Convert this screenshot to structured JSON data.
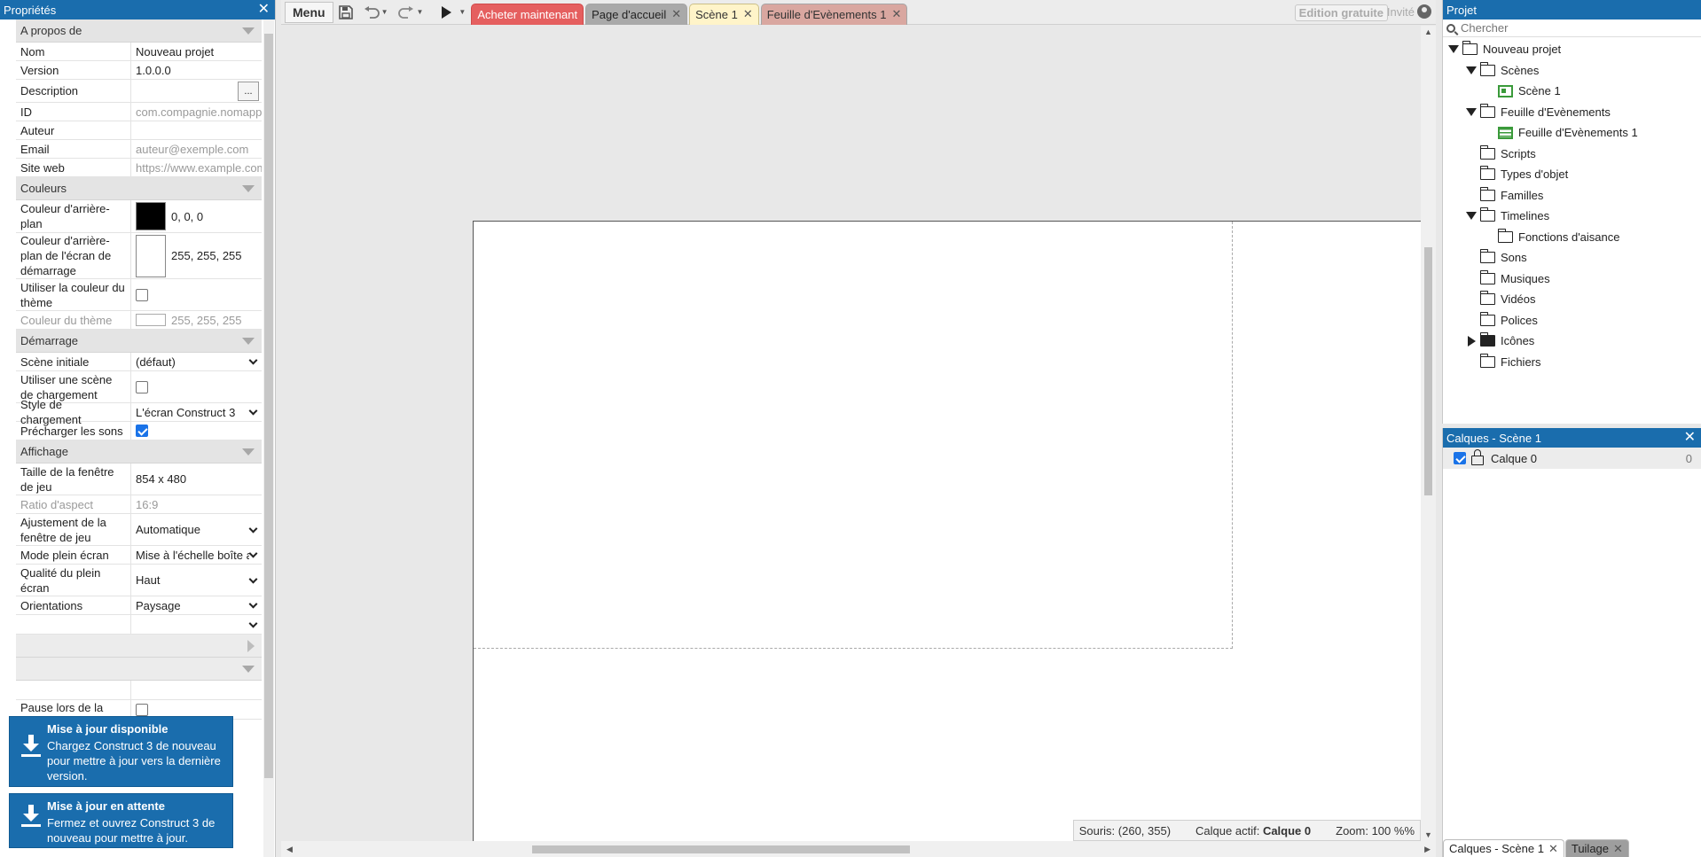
{
  "properties": {
    "header": "Propriétés",
    "sections": {
      "about": "A propos de",
      "colors": "Couleurs",
      "startup": "Démarrage",
      "display": "Affichage"
    },
    "about": {
      "name_label": "Nom",
      "name_value": "Nouveau projet",
      "version_label": "Version",
      "version_value": "1.0.0.0",
      "description_label": "Description",
      "description_button": "...",
      "id_label": "ID",
      "id_placeholder": "com.compagnie.nomapp",
      "author_label": "Auteur",
      "email_label": "Email",
      "email_placeholder": "auteur@exemple.com",
      "website_label": "Site web",
      "website_placeholder": "https://www.example.com"
    },
    "colors": {
      "bg_label": "Couleur d'arrière-plan",
      "bg_value": "0, 0, 0",
      "bg_color": "#000000",
      "splash_label": "Couleur d'arrière-plan de l'écran de démarrage",
      "splash_value": "255, 255, 255",
      "splash_color": "#ffffff",
      "use_theme_label": "Utiliser la couleur du thème",
      "use_theme_checked": false,
      "theme_label": "Couleur du thème",
      "theme_value": "255, 255, 255"
    },
    "startup": {
      "first_scene_label": "Scène initiale",
      "first_scene_value": "(défaut)",
      "use_loader_label": "Utiliser une scène de chargement",
      "use_loader_checked": false,
      "loader_style_label": "Style de chargement",
      "loader_style_value": "L'écran Construct 3",
      "preload_sounds_label": "Précharger les sons",
      "preload_sounds_checked": true
    },
    "display": {
      "viewport_label": "Taille de la fenêtre de jeu",
      "viewport_value": "854 x 480",
      "aspect_label": "Ratio d'aspect",
      "aspect_value": "16:9",
      "fit_label": "Ajustement de la fenêtre de jeu",
      "fit_value": "Automatique",
      "fullscreen_label": "Mode plein écran",
      "fullscreen_value": "Mise à l'échelle boîte aux lettres",
      "quality_label": "Qualité du plein écran",
      "quality_value": "Haut",
      "orient_label": "Orientations",
      "orient_value": "Paysage",
      "pause_label": "Pause lors de la"
    }
  },
  "notifications": [
    {
      "title": "Mise à jour disponible",
      "message": "Chargez Construct 3 de nouveau pour mettre à jour vers la dernière version."
    },
    {
      "title": "Mise à jour en attente",
      "message": "Fermez et ouvrez Construct 3 de nouveau pour mettre à jour."
    }
  ],
  "toolbar": {
    "menu": "Menu",
    "tabs": [
      {
        "label": "Acheter maintenant"
      },
      {
        "label": "Page d'accueil"
      },
      {
        "label": "Scène 1"
      },
      {
        "label": "Feuille d'Evènements 1"
      }
    ],
    "edition": "Edition gratuite",
    "guest": "Invité"
  },
  "status": {
    "mouse": "Souris: (260, 355)",
    "active_layer_prefix": "Calque actif:",
    "active_layer": "Calque 0",
    "zoom": "Zoom: 100 %%"
  },
  "project": {
    "header": "Projet",
    "search_placeholder": "Chercher",
    "tree": {
      "root": "Nouveau projet",
      "scenes": "Scènes",
      "scene1": "Scène 1",
      "event_sheets": "Feuille d'Evènements",
      "event_sheet1": "Feuille d'Evènements 1",
      "scripts": "Scripts",
      "object_types": "Types d'objet",
      "families": "Familles",
      "timelines": "Timelines",
      "easing": "Fonctions d'aisance",
      "sounds": "Sons",
      "music": "Musiques",
      "videos": "Vidéos",
      "fonts": "Polices",
      "icons": "Icônes",
      "files": "Fichiers"
    }
  },
  "layers": {
    "header": "Calques - Scène 1",
    "layer_name": "Calque 0",
    "layer_index": "0",
    "bottom_tabs": [
      "Calques - Scène 1",
      "Tuilage"
    ]
  }
}
